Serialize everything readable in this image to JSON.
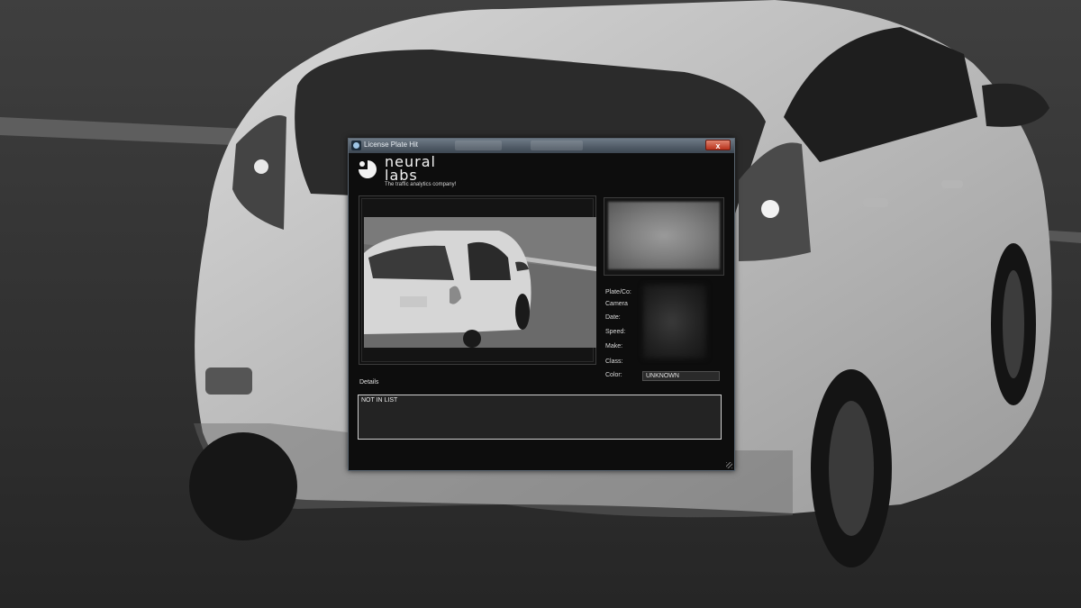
{
  "window": {
    "title": "License Plate Hit",
    "close_label": "x"
  },
  "branding": {
    "logo_text_line1": "neural",
    "logo_text_line2": "labs",
    "tagline": "The traffic analytics company!"
  },
  "info": {
    "labels": [
      "Plate/Co:",
      "Camera",
      "Date:",
      "Speed:",
      "Make:",
      "Class:",
      "Color:"
    ],
    "color_value": "UNKNOWN"
  },
  "details": {
    "label": "Details",
    "text": "NOT IN LIST"
  },
  "icons": {
    "app": "camera-app-icon",
    "close": "close-icon",
    "resize": "resize-grip-icon"
  }
}
